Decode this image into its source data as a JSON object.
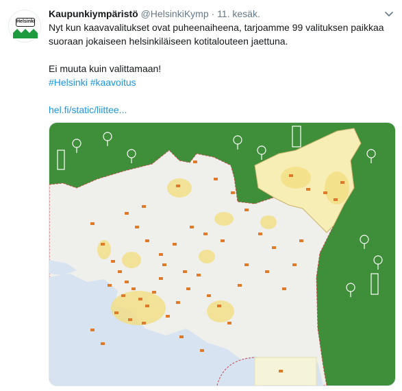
{
  "tweet": {
    "author_name": "Kaupunkiympäristö",
    "handle": "@HelsinkiKymp",
    "separator": "·",
    "time": "11. kesäk.",
    "avatar_text": "Helsinki",
    "line1": "Nyt kun kaavavalitukset ovat puheenaiheena, tarjoamme 99 valituksen paikkaa suoraan jokaiseen helsinkiläiseen kotitalouteen jaettuna.",
    "line2": "Ei muuta kuin valittamaan!",
    "hashtag1": "#Helsinki",
    "hashtag2": "#kaavoitus",
    "url": "hel.fi/static/liittee..."
  },
  "colors": {
    "link": "#1b95e0",
    "map_green": "#3f8f3a",
    "land": "#f2f2f0",
    "water": "#dce6f2",
    "marker": "#e07a2b",
    "area_fill": "#f6e58d"
  },
  "icons": {
    "menu": "chevron-down-icon"
  }
}
